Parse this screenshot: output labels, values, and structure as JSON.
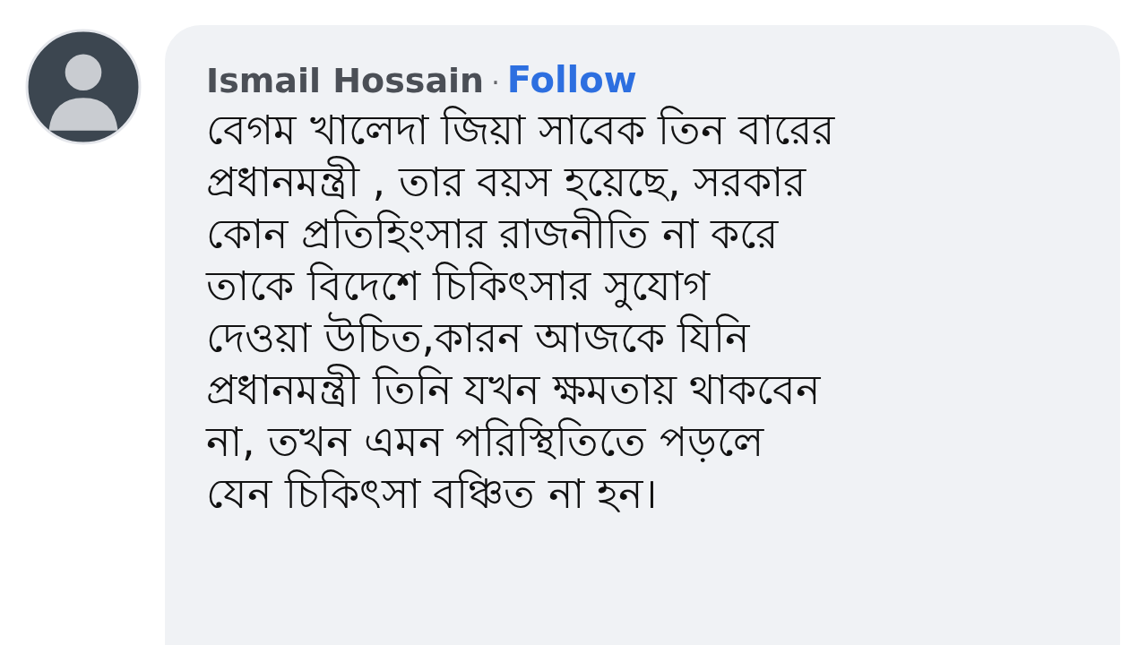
{
  "comment": {
    "author": "Ismail Hossain",
    "separator": "·",
    "follow": "Follow",
    "text": "বেগম খালেদা জিয়া সাবেক তিন বারের\nপ্রধানমন্ত্রী , তার বয়স হয়েছে, সরকার\nকোন প্রতিহিংসার রাজনীতি না করে\nতাকে বিদেশে চিকিৎসার সুযোগ\nদেওয়া উচিত,কারন আজকে যিনি\nপ্রধানমন্ত্রী তিনি যখন ক্ষমতায় থাকবেন\nনা, তখন এমন পরিস্থিতিতে পড়লে\nযেন চিকিৎসা বঞ্চিত না হন।"
  }
}
